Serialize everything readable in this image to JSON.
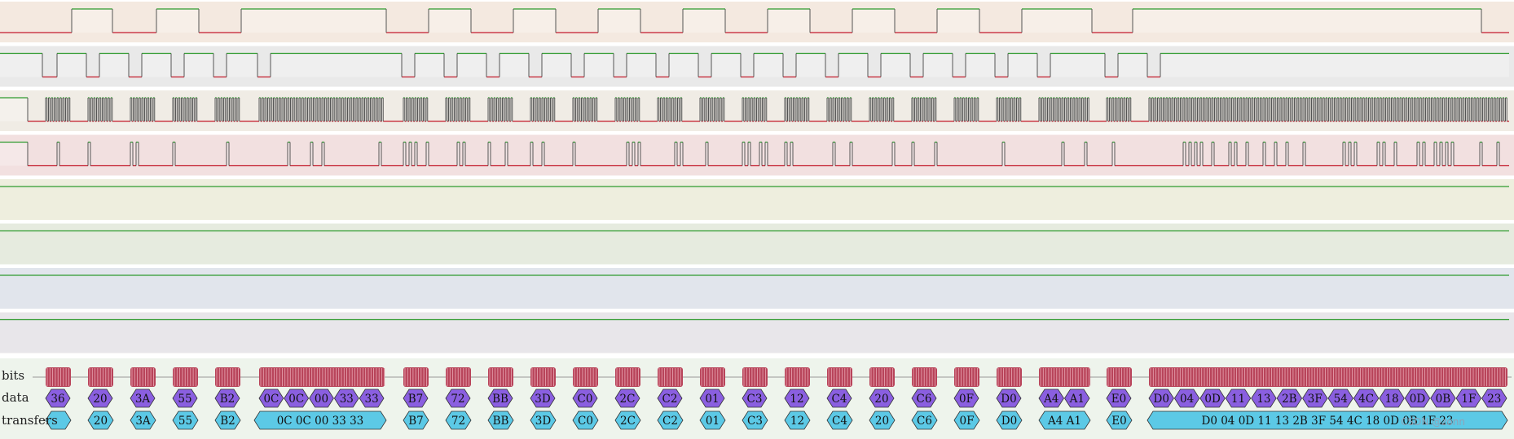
{
  "colors": {
    "trace_high": "#2e9a2e",
    "trace_low": "#c41c2c",
    "bits_fill": "#b8445a",
    "data_fill": "#8a5fe0",
    "transfer_fill": "#5cc9e6",
    "row_backgrounds": [
      "#f4e9e0",
      "#e9e9e9",
      "#f0ece5",
      "#f2e0e0",
      "#eeeede",
      "#e6ebdf",
      "#e1e5ec",
      "#e8e6ea"
    ]
  },
  "decoder": {
    "labels": {
      "bits": "bits",
      "data": "data",
      "transfers": "transfers"
    },
    "data_bytes": [
      "36",
      "20",
      "3A",
      "55",
      "B2",
      "0C",
      "0C",
      "00",
      "33",
      "33",
      "B7",
      "72",
      "BB",
      "3D",
      "C0",
      "2C",
      "C2",
      "01",
      "C3",
      "12",
      "C4",
      "20",
      "C6",
      "0F",
      "D0",
      "A4",
      "A1",
      "E0",
      "D0",
      "04",
      "0D",
      "11",
      "13",
      "2B",
      "3F",
      "54",
      "4C",
      "18",
      "0D",
      "0B",
      "1F",
      "23"
    ],
    "transfers": [
      "20",
      "3A",
      "55",
      "B2",
      "0C 0C 00 33 33",
      "B7",
      "72",
      "BB",
      "3D",
      "C0",
      "2C",
      "C2",
      "01",
      "C3",
      "12",
      "C4",
      "20",
      "C6",
      "0F",
      "D0",
      "A4 A1",
      "E0",
      "D0 04 0D 11 13 2B 3F 54 4C 18 0D 0B 1F 23"
    ]
  },
  "watermark": "CSDN @zonn"
}
